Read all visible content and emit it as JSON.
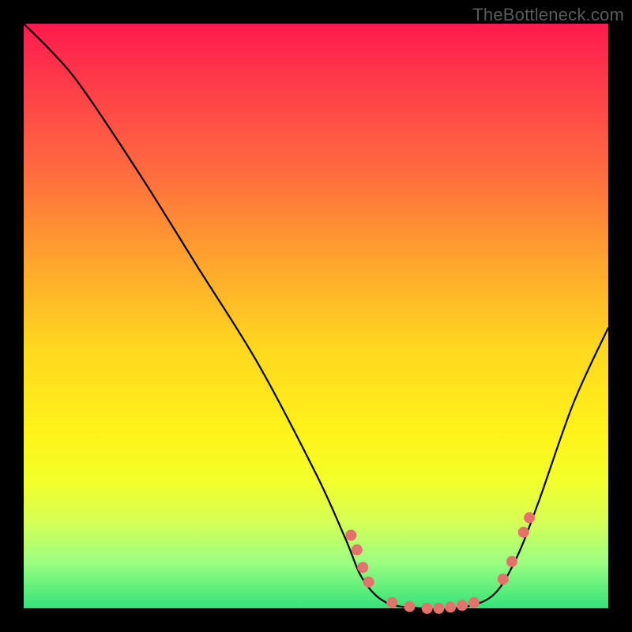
{
  "watermark": "TheBottleneck.com",
  "chart_data": {
    "type": "line",
    "title": "",
    "xlabel": "",
    "ylabel": "",
    "xlim": [
      0,
      100
    ],
    "ylim": [
      0,
      100
    ],
    "series": [
      {
        "name": "curve",
        "points": [
          {
            "x": 0,
            "y": 100
          },
          {
            "x": 5,
            "y": 95
          },
          {
            "x": 10,
            "y": 89
          },
          {
            "x": 20,
            "y": 74
          },
          {
            "x": 30,
            "y": 58
          },
          {
            "x": 40,
            "y": 42
          },
          {
            "x": 50,
            "y": 23
          },
          {
            "x": 55,
            "y": 12
          },
          {
            "x": 58,
            "y": 5
          },
          {
            "x": 62,
            "y": 1
          },
          {
            "x": 68,
            "y": 0
          },
          {
            "x": 74,
            "y": 0
          },
          {
            "x": 80,
            "y": 2
          },
          {
            "x": 84,
            "y": 8
          },
          {
            "x": 88,
            "y": 18
          },
          {
            "x": 94,
            "y": 35
          },
          {
            "x": 100,
            "y": 48
          }
        ]
      }
    ],
    "markers": [
      {
        "x": 56.0,
        "y": 12.5
      },
      {
        "x": 57.0,
        "y": 10.0
      },
      {
        "x": 58.0,
        "y": 7.0
      },
      {
        "x": 59.0,
        "y": 4.5
      },
      {
        "x": 63.0,
        "y": 1.0
      },
      {
        "x": 66.0,
        "y": 0.3
      },
      {
        "x": 69.0,
        "y": 0.0
      },
      {
        "x": 71.0,
        "y": 0.0
      },
      {
        "x": 73.0,
        "y": 0.2
      },
      {
        "x": 75.0,
        "y": 0.5
      },
      {
        "x": 77.0,
        "y": 1.0
      },
      {
        "x": 82.0,
        "y": 5.0
      },
      {
        "x": 83.5,
        "y": 8.0
      },
      {
        "x": 85.5,
        "y": 13.0
      },
      {
        "x": 86.5,
        "y": 15.5
      }
    ],
    "gradient_stops": [
      {
        "pos": 0.0,
        "color": "#ff1a4d"
      },
      {
        "pos": 0.1,
        "color": "#ff3b4a"
      },
      {
        "pos": 0.25,
        "color": "#ff6a3f"
      },
      {
        "pos": 0.4,
        "color": "#ffa22e"
      },
      {
        "pos": 0.55,
        "color": "#ffd61f"
      },
      {
        "pos": 0.7,
        "color": "#fff31a"
      },
      {
        "pos": 0.78,
        "color": "#f3ff29"
      },
      {
        "pos": 0.85,
        "color": "#d7ff55"
      },
      {
        "pos": 0.92,
        "color": "#9cff80"
      },
      {
        "pos": 1.0,
        "color": "#34e27a"
      }
    ],
    "marker_color": "#e4716c",
    "curve_color": "#000000"
  }
}
